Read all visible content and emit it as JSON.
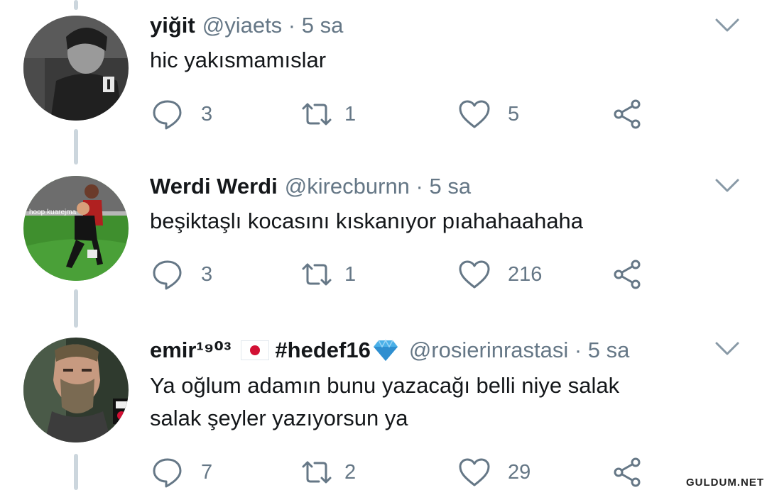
{
  "tweets": [
    {
      "name": "yiğit",
      "meta": "@yiaets · 5 sa",
      "text_lines": [
        "hic yakısmamıslar"
      ],
      "replies": "3",
      "retweets": "1",
      "likes": "5"
    },
    {
      "name": "Werdi Werdi",
      "meta": "@kirecburnn · 5 sa",
      "avatar_caption": "hoop kuarejma",
      "text_lines": [
        "beşiktaşlı kocasını kıskanıyor pıahahaahaha"
      ],
      "replies": "3",
      "retweets": "1",
      "likes": "216"
    },
    {
      "name": "emir¹⁹⁰³",
      "hashtag": "#hedef16",
      "meta": "@rosierinrastasi · 5 sa",
      "text_lines": [
        "Ya oğlum adamın bunu yazacağı belli niye salak",
        "salak şeyler yazıyorsun ya"
      ],
      "replies": "7",
      "retweets": "2",
      "likes": "29"
    }
  ],
  "watermark": "GULDUM.NET",
  "colors": {
    "muted": "#657786",
    "thread_line": "#ccd6dd",
    "flag_red": "#d21034",
    "diamond": "#4ab0e8"
  },
  "icons": [
    "reply-icon",
    "retweet-icon",
    "like-icon",
    "share-icon",
    "chevron-down-icon",
    "japan-flag-icon",
    "diamond-icon"
  ]
}
